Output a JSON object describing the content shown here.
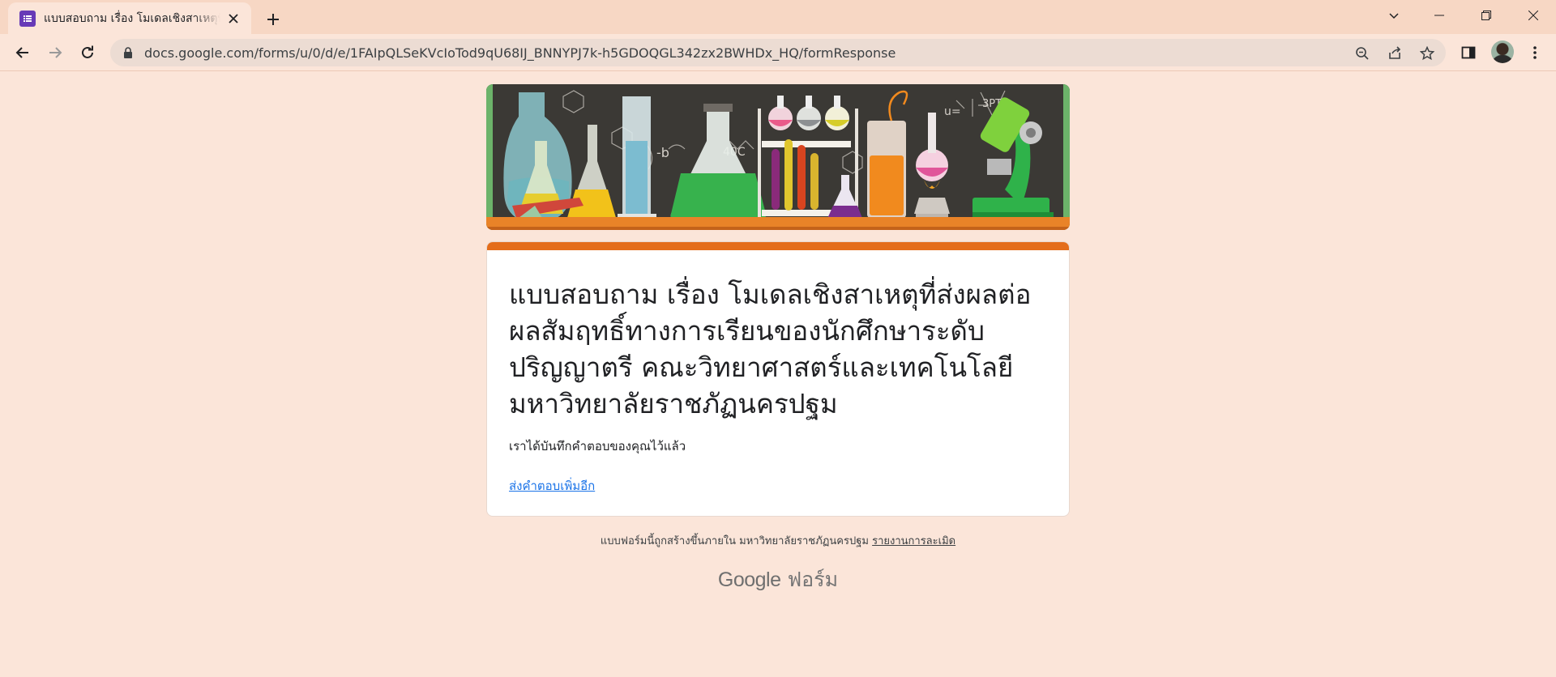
{
  "browser": {
    "tab_title": "แบบสอบถาม เรื่อง โมเดลเชิงสาเหตุที่ส่งผล",
    "url": "docs.google.com/forms/u/0/d/e/1FAIpQLSeKVcIoTod9qU68IJ_BNNYPJ7k-h5GDOQGL342zx2BWHDx_HQ/formResponse"
  },
  "form": {
    "title": "แบบสอบถาม เรื่อง โมเดลเชิงสาเหตุที่ส่งผลต่อผลสัมฤทธิ์ทางการเรียนของนักศึกษาระดับปริญญาตรี คณะวิทยาศาสตร์และเทคโนโลยี มหาวิทยาลัยราชภัฏนครปฐม",
    "confirmation": "เราได้บันทึกคำตอบของคุณไว้แล้ว",
    "submit_another": "ส่งคำตอบเพิ่มอีก",
    "accent_color": "#e46d1b"
  },
  "footer": {
    "created_text": "แบบฟอร์มนี้ถูกสร้างขึ้นภายใน มหาวิทยาลัยราชภัฏนครปฐม",
    "report_link": "รายงานการละเมิด",
    "logo_google": "Google",
    "logo_forms": "ฟอร์ม"
  }
}
